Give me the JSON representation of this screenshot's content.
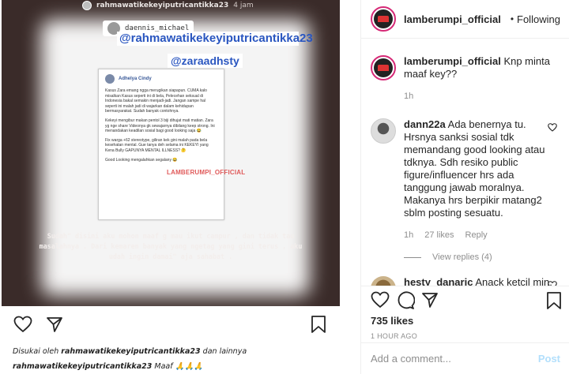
{
  "story": {
    "header_user": "rahmawatikekeyiputricantikka23",
    "header_time": "4 jam",
    "tag_user": "daennis_michael",
    "mention_main": "@rahmawatikekeyiputricantikka23",
    "mention_second": "@zaraadhsty",
    "fb_author": "Adhelya Cindy",
    "fb_paragraphs": [
      "Kasus Zara emang ngga merugikan siapapun. CUMA kalo misalkan Kasus seperti ini di bela, Pelecehan seksual di Indonesia bakal semakin menjadi-jadi. Jangan sampe hal seperti ini malah jadi di wajarkan dalam kehidupan bermasyarakat. Sudah banyak contohnya.",
      "Kekeyi mengibur makan pentol 3 biji dihujat mati matian. Zara yg nge share Videonya gk sewajarnya dibilang keep strong. Ini menandakan keadilan sosial bagi good looking saja 😂",
      "Fix warga +62 stereotype, giliran kek gini malah pada bela kesehatan mental. Gue tanya deh selama ini KEKEYI yang Kena Bully GAPUNYA MENTAL ILLNESS? 🤔",
      "Good Looking mengalahkan segalany 😂"
    ],
    "watermark": "LAMBERUMPI_OFFICIAL",
    "caption": "Sudah\" disini aku mohon maaf g mau ikut campur , dan tidak tau masalahnya . Dari kemaren banyak yang ngetag yang gini terus , aku udah ingin damai\" aja sahabat ."
  },
  "left_footer": {
    "liked_by_prefix": "Disukai oleh",
    "liked_by_user": "rahmawatikekeyiputricantikka23",
    "liked_by_suffix": "dan lainnya",
    "comment_user": "rahmawatikekeyiputricantikka23",
    "comment_text": "Maaf 🙏🙏🙏"
  },
  "panel": {
    "account": "lamberumpi_official",
    "follow_label": "Following",
    "dot": "•"
  },
  "comments": [
    {
      "user": "lamberumpi_official",
      "text": "Knp minta maaf key??",
      "time": "1h",
      "likes": "",
      "reply": ""
    },
    {
      "user": "dann22a",
      "text": "Ada benernya tu. Hrsnya sanksi sosial tdk memandang good looking atau tdknya. Sdh resiko public figure/influencer hrs ada tanggung jawab moralnya. Makanya hrs berpikir matang2 sblm posting sesuatu.",
      "time": "1h",
      "likes": "27 likes",
      "reply": "Reply"
    },
    {
      "user": "hesty_danaric",
      "text": "Anack ketcil min, ga tau mksudnya dia 😄",
      "time": "",
      "likes": "",
      "reply": ""
    }
  ],
  "view_replies": "View replies (4)",
  "likes_count": "735 likes",
  "time_ago": "1 HOUR AGO",
  "add_comment_placeholder": "Add a comment...",
  "post_label": "Post",
  "colors": {
    "story_bg": "#3a2b29",
    "mention": "#2a56c0",
    "post_disabled": "#b2dffc"
  }
}
